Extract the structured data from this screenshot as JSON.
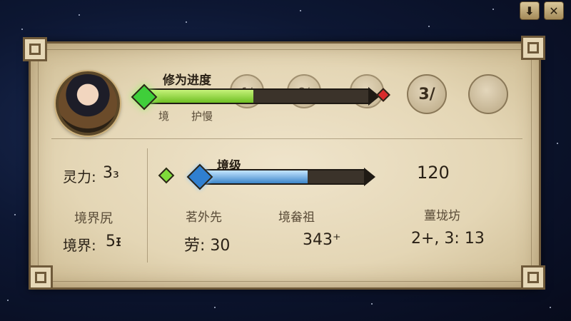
{
  "window": {
    "sort_icon": "download-arrow-icon",
    "close_icon": "close-icon"
  },
  "header": {
    "progress_title": "修为进度",
    "progress_sub_1": "境",
    "progress_sub_2": "护慢",
    "progress_fraction": 0.48,
    "slot_labels": [
      "1/",
      "2/",
      "3/",
      ""
    ]
  },
  "stats": {
    "spirit_label": "灵力:",
    "spirit_value": "3₃",
    "realm_caption": "境界尻",
    "realm_label": "境界:",
    "realm_value": "5ᵻ"
  },
  "realm_bar": {
    "title": "境级",
    "value": "120",
    "fraction": 0.65
  },
  "details": {
    "headers": [
      "茗外先",
      "境畚祖",
      "薑垅坊"
    ],
    "values": [
      "劳: 30",
      "343⁺",
      "2+, 3: 13"
    ]
  },
  "colors": {
    "progress_green": "#8fd63a",
    "realm_blue": "#6fb4e8",
    "gem_green": "#3fcf3a",
    "gem_red": "#d92b2b"
  }
}
